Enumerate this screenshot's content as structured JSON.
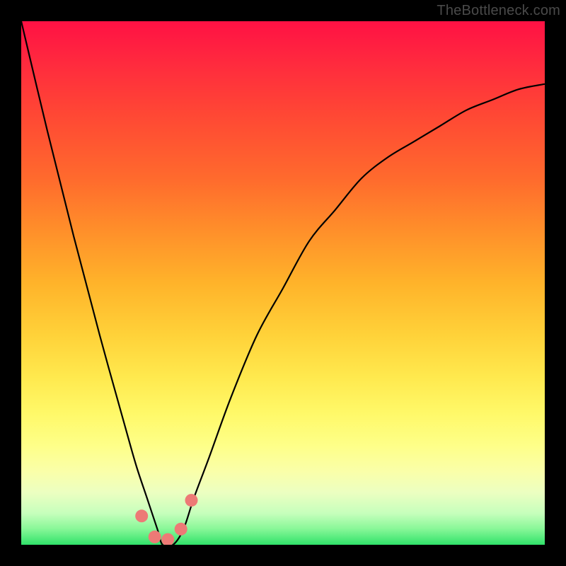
{
  "watermark": "TheBottleneck.com",
  "chart_data": {
    "type": "line",
    "title": "",
    "xlabel": "",
    "ylabel": "",
    "xlim": [
      0,
      1
    ],
    "ylim": [
      0,
      1
    ],
    "series": [
      {
        "name": "bottleneck-curve",
        "x": [
          0.0,
          0.05,
          0.1,
          0.15,
          0.2,
          0.22,
          0.24,
          0.26,
          0.27,
          0.29,
          0.31,
          0.33,
          0.36,
          0.4,
          0.45,
          0.5,
          0.55,
          0.6,
          0.65,
          0.7,
          0.75,
          0.8,
          0.85,
          0.9,
          0.95,
          1.0
        ],
        "values": [
          1.0,
          0.79,
          0.59,
          0.4,
          0.22,
          0.15,
          0.09,
          0.03,
          0.0,
          0.0,
          0.03,
          0.09,
          0.17,
          0.28,
          0.4,
          0.49,
          0.58,
          0.64,
          0.7,
          0.74,
          0.77,
          0.8,
          0.83,
          0.85,
          0.87,
          0.88
        ]
      }
    ],
    "markers": {
      "name": "highlight-dots",
      "x": [
        0.23,
        0.255,
        0.28,
        0.305,
        0.325
      ],
      "values": [
        0.055,
        0.015,
        0.01,
        0.03,
        0.085
      ],
      "color": "#ed7a76",
      "radius": 9
    },
    "gradient_stops": [
      {
        "pos": 0.0,
        "color": "#ff1144"
      },
      {
        "pos": 0.5,
        "color": "#ffd239"
      },
      {
        "pos": 0.85,
        "color": "#feff88"
      },
      {
        "pos": 1.0,
        "color": "#30e26a"
      }
    ]
  }
}
